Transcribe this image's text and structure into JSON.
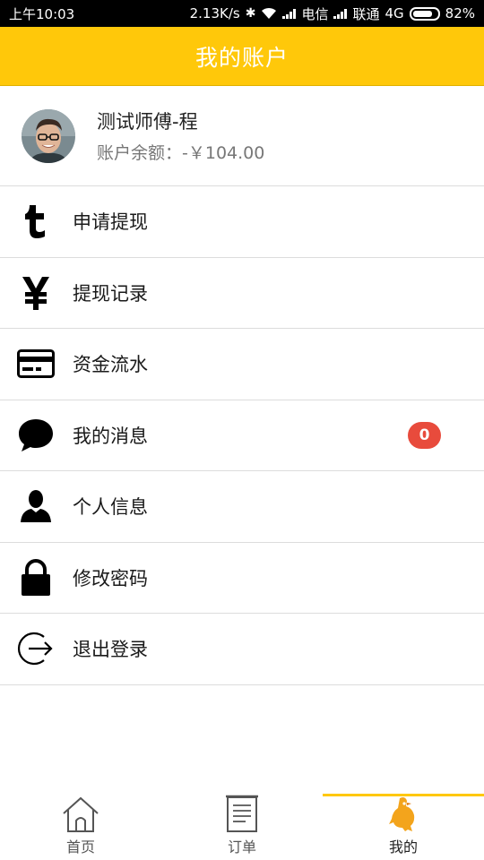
{
  "status_bar": {
    "time": "上午10:03",
    "speed": "2.13K/s",
    "carrier1": "电信",
    "carrier2": "联通",
    "network": "4G",
    "battery": "82%",
    "battery_level": 0.82
  },
  "header": {
    "title": "我的账户"
  },
  "profile": {
    "name": "测试师傅-程",
    "balance_label": "账户余额：",
    "balance_value": "-￥104.00"
  },
  "menu": {
    "items": [
      {
        "label": "申请提现",
        "icon": "tumblr-t-icon"
      },
      {
        "label": "提现记录",
        "icon": "yen-icon"
      },
      {
        "label": "资金流水",
        "icon": "credit-card-icon"
      },
      {
        "label": "我的消息",
        "icon": "chat-bubble-icon",
        "badge": "0"
      },
      {
        "label": "个人信息",
        "icon": "user-icon"
      },
      {
        "label": "修改密码",
        "icon": "lock-icon"
      },
      {
        "label": "退出登录",
        "icon": "sign-out-icon"
      }
    ]
  },
  "tabs": [
    {
      "label": "首页",
      "icon": "home-icon"
    },
    {
      "label": "订单",
      "icon": "document-icon"
    },
    {
      "label": "我的",
      "icon": "mascot-icon",
      "active": true
    }
  ],
  "colors": {
    "accent": "#ffc80a",
    "badge": "#e84b3c"
  }
}
